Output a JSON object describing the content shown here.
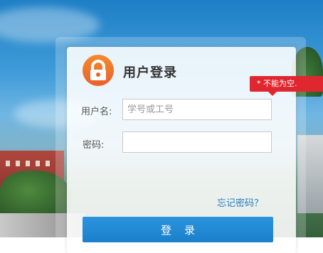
{
  "login": {
    "title": "用户登录",
    "username_label": "用户名:",
    "username_placeholder": "学号或工号",
    "username_value": "",
    "password_label": "密码:",
    "password_value": "",
    "error_tooltip": "* 不能为空.",
    "forgot_link": "忘记密码？",
    "login_button": "登录"
  },
  "colors": {
    "accent_blue": "#1b7fca",
    "logo_orange": "#e8612a",
    "error_red": "#e0262e",
    "link_blue": "#2a7bc0"
  },
  "icons": {
    "logo": "lock-user-icon"
  }
}
